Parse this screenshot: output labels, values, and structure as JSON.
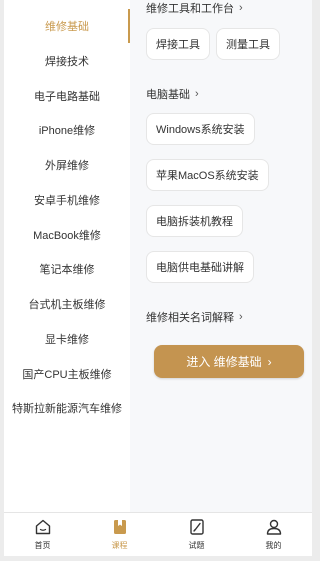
{
  "sidebar": {
    "items": [
      {
        "label": "维修基础",
        "active": true
      },
      {
        "label": "焊接技术"
      },
      {
        "label": "电子电路基础"
      },
      {
        "label": "iPhone维修"
      },
      {
        "label": "外屏维修"
      },
      {
        "label": "安卓手机维修"
      },
      {
        "label": "MacBook维修"
      },
      {
        "label": "笔记本维修"
      },
      {
        "label": "台式机主板维修"
      },
      {
        "label": "显卡维修"
      },
      {
        "label": "国产CPU主板维修"
      },
      {
        "label": "特斯拉新能源汽车维修"
      }
    ]
  },
  "content": {
    "sections": [
      {
        "title": "维修工具和工作台",
        "chips": [
          "焊接工具",
          "测量工具"
        ]
      },
      {
        "title": "电脑基础",
        "chips": [
          "Windows系统安装",
          "苹果MacOS系统安装",
          "电脑拆装机教程",
          "电脑供电基础讲解"
        ]
      },
      {
        "title": "维修相关名词解释",
        "chips": []
      }
    ],
    "cta_label": "进入 维修基础"
  },
  "tabbar": {
    "tabs": [
      {
        "label": "首页",
        "icon": "home-icon"
      },
      {
        "label": "课程",
        "icon": "book-icon",
        "active": true
      },
      {
        "label": "试题",
        "icon": "exam-icon"
      },
      {
        "label": "我的",
        "icon": "user-icon"
      }
    ]
  },
  "colors": {
    "accent": "#c99a4e",
    "cta": "#c49450",
    "content_bg": "#f7f8fa"
  }
}
